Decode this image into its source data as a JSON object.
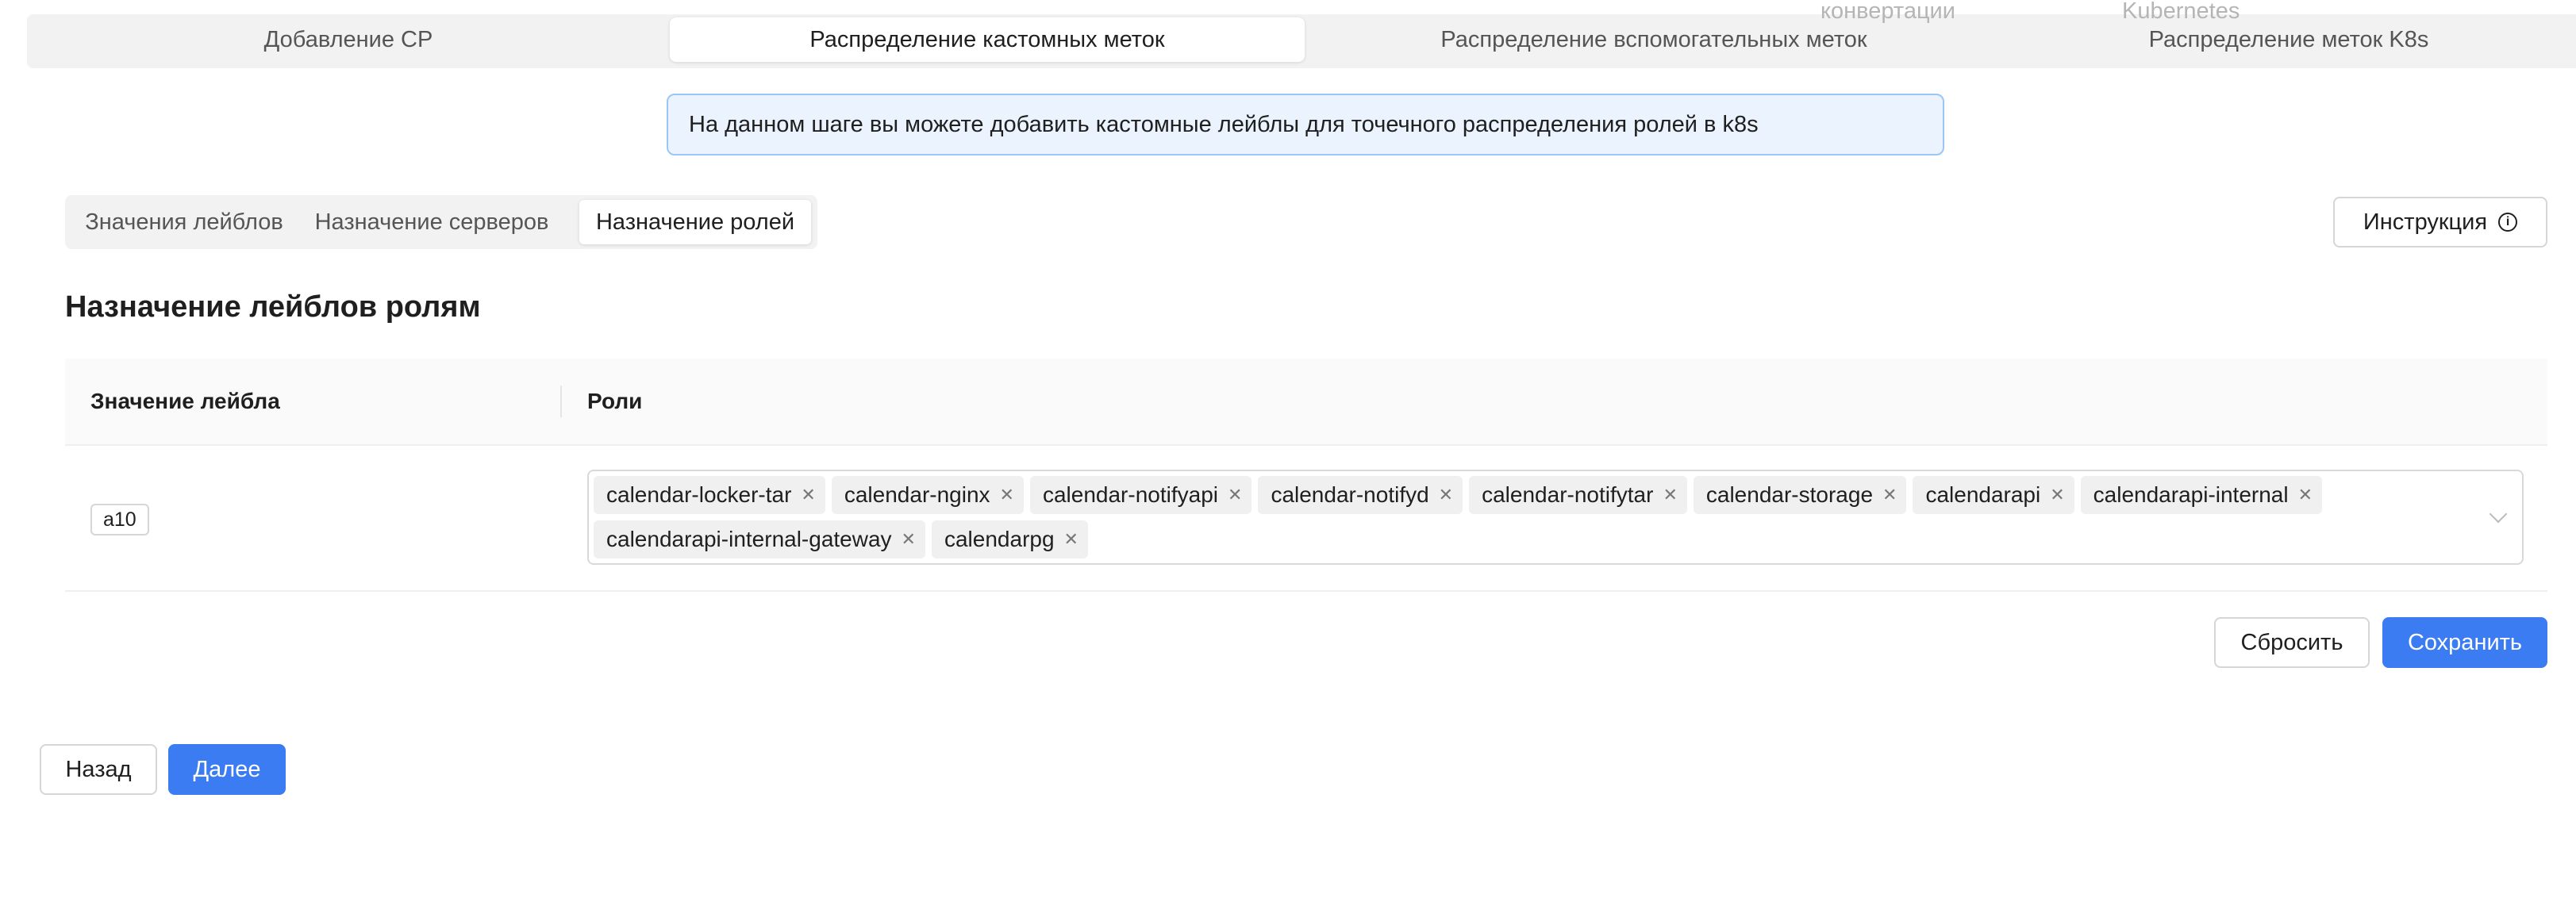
{
  "steps": {
    "partial_above": [
      "конвертации",
      "Kubernetes"
    ],
    "items": [
      {
        "label": "Добавление СР"
      },
      {
        "label": "Распределение кастомных меток"
      },
      {
        "label": "Распределение вспомогательных меток"
      },
      {
        "label": "Распределение меток K8s"
      }
    ],
    "active_index": 1
  },
  "info_banner": {
    "text": "На данном шаге вы можете добавить кастомные лейблы для точечного распределения ролей в k8s"
  },
  "subtabs": {
    "items": [
      {
        "label": "Значения лейблов"
      },
      {
        "label": "Назначение серверов"
      },
      {
        "label": "Назначение ролей"
      }
    ],
    "active_index": 2
  },
  "instruction_button": {
    "label": "Инструкция",
    "icon": "info-circle-icon"
  },
  "section": {
    "title": "Назначение лейблов ролям"
  },
  "table": {
    "columns": [
      "Значение лейбла",
      "Роли"
    ],
    "rows": [
      {
        "label_value": "a10",
        "roles": [
          "calendar-locker-tar",
          "calendar-nginx",
          "calendar-notifyapi",
          "calendar-notifyd",
          "calendar-notifytar",
          "calendar-storage",
          "calendarapi",
          "calendarapi-internal",
          "calendarapi-internal-gateway",
          "calendarpg"
        ]
      }
    ]
  },
  "actions": {
    "reset_label": "Сбросить",
    "save_label": "Сохранить"
  },
  "footer": {
    "back_label": "Назад",
    "next_label": "Далее"
  },
  "colors": {
    "primary": "#3b7cf3",
    "info_bg": "#eaf3fe",
    "info_border": "#9cc6f5"
  }
}
